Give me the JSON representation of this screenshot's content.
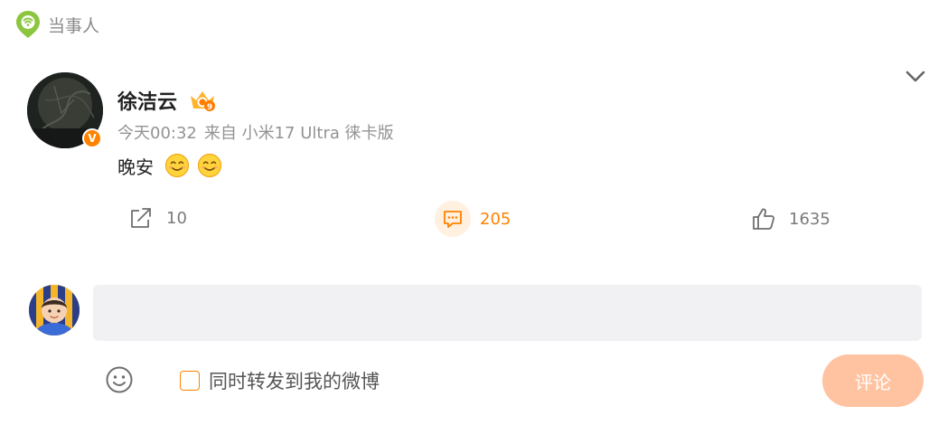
{
  "header": {
    "label": "当事人",
    "icon": "location-pin-icon"
  },
  "post": {
    "author": "徐洁云",
    "verified_badge": "V",
    "rank_badge_number": "9",
    "time": "今天00:32",
    "source": "来自 小米17 Ultra 徕卡版",
    "text": "晚安",
    "emojis": [
      "smile-emoji",
      "smile-emoji"
    ]
  },
  "actions": {
    "repost_count": "10",
    "comment_count": "205",
    "like_count": "1635"
  },
  "composer": {
    "input_value": "",
    "placeholder": "",
    "repost_label": "同时转发到我的微博",
    "repost_checked": false,
    "submit_label": "评论"
  },
  "colors": {
    "accent": "#ff8200",
    "pin": "#8cc63f",
    "submit_disabled": "#ffc3a1",
    "input_bg": "#f1f1f4",
    "muted_text": "#939393"
  }
}
